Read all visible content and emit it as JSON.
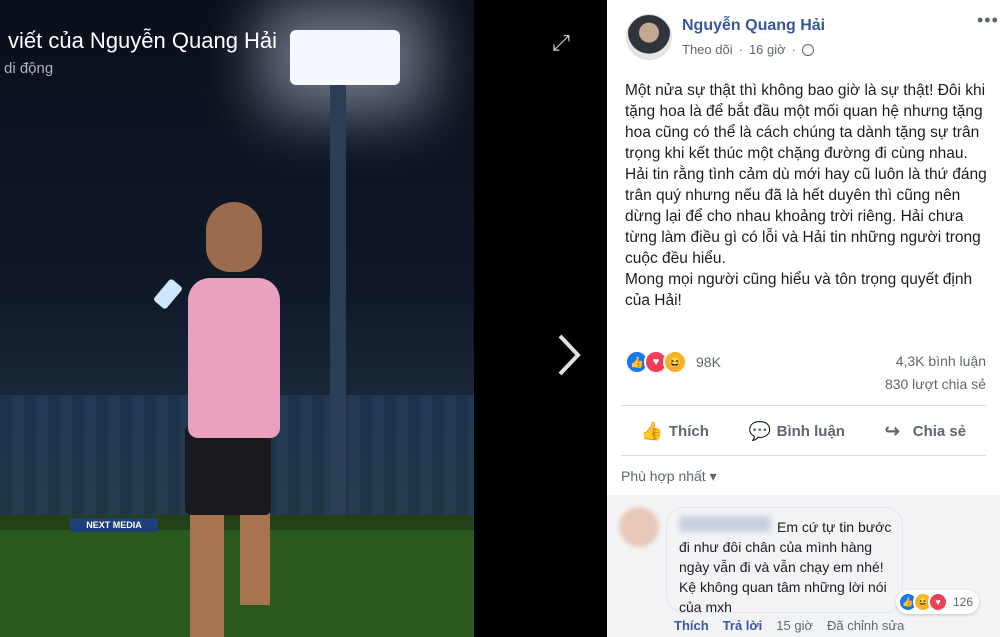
{
  "viewer": {
    "title": "viết của Nguyễn Quang Hải",
    "subtitle": "di động",
    "banner_text": "NEXT MEDIA"
  },
  "post": {
    "author": "Nguyễn Quang Hải",
    "follow_label": "Theo dõi",
    "time": "16 giờ",
    "paragraphs": [
      "Một nửa sự thật thì không bao giờ là sự thật! Đôi khi tặng hoa là để bắt đầu một mối quan hệ nhưng tặng hoa cũng có thể là cách chúng ta dành tặng sự trân trọng khi kết thúc một chặng đường đi cùng nhau.",
      "Hải tin rằng tình cảm dù mới hay cũ luôn là thứ đáng trân quý nhưng nếu đã là hết duyên thì cũng nên dừng lại để cho nhau khoảng trời riêng. Hải chưa từng làm điều gì có lỗi và Hải tin những người trong cuộc đều hiểu.",
      "Mong mọi người cũng hiểu và tôn trọng quyết định của Hải!"
    ],
    "reaction_count": "98K",
    "comments_count": "4,3K bình luận",
    "shares_count": "830 lượt chia sẻ",
    "actions": {
      "like": "Thích",
      "comment": "Bình luận",
      "share": "Chia sẻ"
    },
    "sort_label": "Phù hợp nhất"
  },
  "comment": {
    "text": "Em cứ tự tin bước đi như đôi chân của mình hàng ngày vẫn đi và vẫn chạy em nhé! Kệ không quan tâm những lời nói của mxh",
    "reaction_count": "126",
    "like": "Thích",
    "reply": "Trả lời",
    "time": "15 giờ",
    "edited": "Đã chỉnh sửa"
  }
}
